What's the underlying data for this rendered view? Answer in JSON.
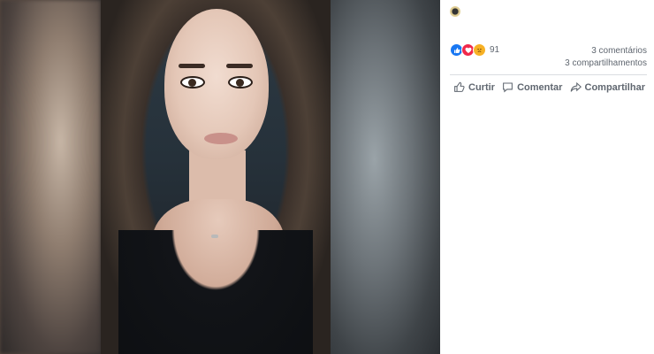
{
  "post": {
    "reactions": {
      "icons": [
        "like-icon",
        "love-icon",
        "sad-icon"
      ],
      "count": "91"
    },
    "comments_text": "3 comentários",
    "shares_text": "3 compartilhamentos"
  },
  "actions": {
    "like_label": "Curtir",
    "comment_label": "Comentar",
    "share_label": "Compartilhar"
  },
  "colors": {
    "like_blue": "#1877f2",
    "love_red": "#f0284a",
    "sad_yellow": "#f7b125",
    "meta_text": "#606770",
    "divider": "#dadde1"
  }
}
